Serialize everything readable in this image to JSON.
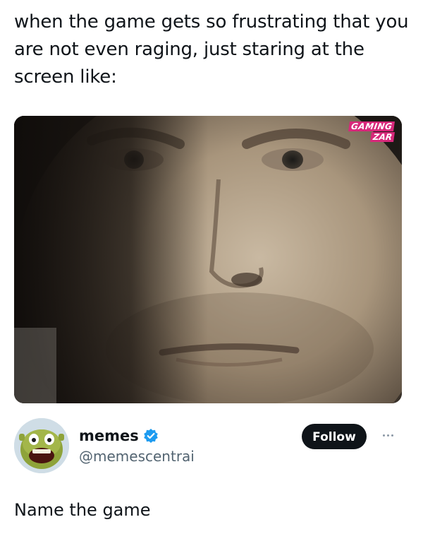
{
  "meme": {
    "caption": "when the game gets so frustrating that you are not even raging, just staring at the screen like:",
    "image": {
      "description_icon": "closeup-face-photo",
      "watermark_line1": "GAMING",
      "watermark_line2": "ZAR",
      "watermark_color": "#d7287a"
    }
  },
  "embedded_post": {
    "avatar_icon": "shrek-avatar-icon",
    "display_name": "memes",
    "verified_icon": "verified-badge-icon",
    "verified_color": "#1d9bf0",
    "handle": "@memescentrai",
    "follow_label": "Follow",
    "more_icon": "more-options-icon",
    "text": "Name the game"
  }
}
